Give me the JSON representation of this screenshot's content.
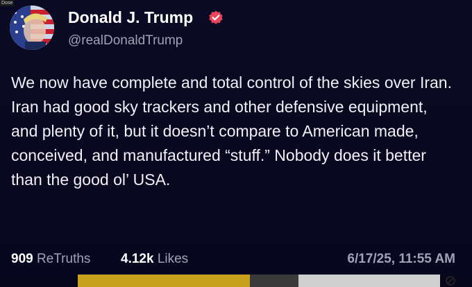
{
  "corner_label": "Dose",
  "author": {
    "display_name": "Donald J. Trump",
    "handle": "@realDonaldTrump",
    "verified_icon": "verified-badge-icon",
    "verified_color": "#e8445a"
  },
  "post": {
    "text": "We now have complete and total control of the skies over Iran. Iran had good sky trackers and other defensive equipment, and plenty of it, but it doesn’t compare to American made, conceived, and manufactured “stuff.” Nobody does it better than the good ol’ USA."
  },
  "stats": {
    "retruths_count": "909",
    "retruths_label": "ReTruths",
    "likes_count": "4.12k",
    "likes_label": "Likes",
    "timestamp": "6/17/25, 11:55 AM"
  },
  "colors": {
    "background": "#0b0a24",
    "text_primary": "#ffffff",
    "text_secondary": "#a3a1b6"
  }
}
